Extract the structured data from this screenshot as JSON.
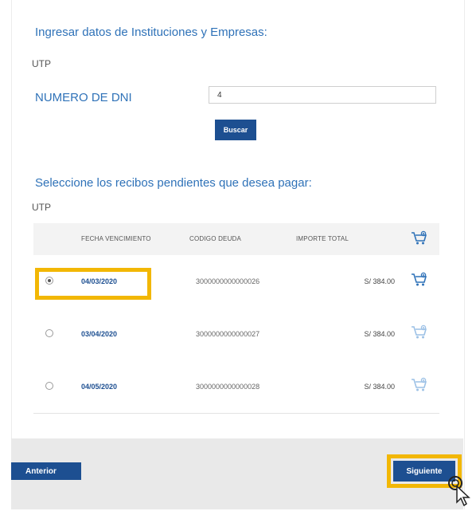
{
  "form": {
    "title": "Ingresar datos de Instituciones y Empresas:",
    "institution": "UTP",
    "dni_label": "NUMERO DE DNI",
    "dni_value": "4",
    "search_label": "Buscar"
  },
  "receipts": {
    "title": "Seleccione los recibos pendientes que desea pagar:",
    "institution": "UTP",
    "headers": {
      "due_date": "FECHA VENCIMIENTO",
      "code": "CODIGO DEUDA",
      "amount": "IMPORTE TOTAL",
      "cart_icon": "cart-icon"
    },
    "rows": [
      {
        "date": "04/03/2020",
        "code": "3000000000000026",
        "amount": "S/ 384.00",
        "selected": true
      },
      {
        "date": "03/04/2020",
        "code": "3000000000000027",
        "amount": "S/ 384.00",
        "selected": false
      },
      {
        "date": "04/05/2020",
        "code": "3000000000000028",
        "amount": "S/ 384.00",
        "selected": false
      }
    ]
  },
  "navigation": {
    "previous_label": "Anterior",
    "next_label": "Siguiente"
  },
  "colors": {
    "accent_blue": "#2f72b8",
    "button_blue": "#1d4f91",
    "highlight_yellow": "#f2b705"
  }
}
